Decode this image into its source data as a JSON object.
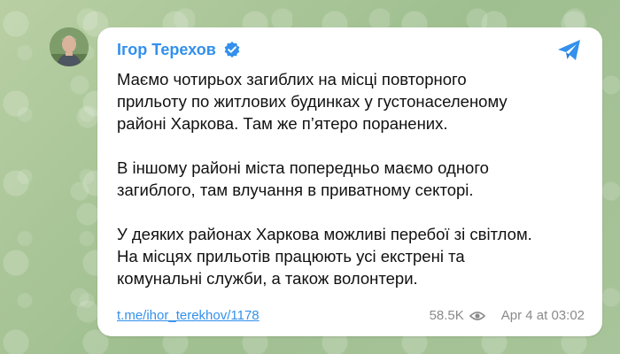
{
  "post": {
    "author": "Ігор Терехов",
    "paragraphs": [
      "Маємо чотирьох загиблих на місці повторного\nприльоту по житлових будинках у густонаселеному\nрайоні Харкова. Там же п’ятеро поранених.",
      "В іншому районі міста попередньо маємо одного\nзагиблого, там влучання в приватному секторі.",
      "У деяких районах Харкова можливі перебої зі світлом.\nНа місцях прильотів працюють усі екстрені та\nкомунальні служби, а також волонтери."
    ],
    "link": "t.me/ihor_terekhov/1178",
    "views": "58.5K",
    "date": "Apr 4 at 03:02"
  },
  "colors": {
    "accent": "#3390ec",
    "meta": "#8a8a8a",
    "text": "#111111"
  },
  "icons": {
    "verified": "verified-badge-icon",
    "share": "telegram-share-icon",
    "views": "eye-icon"
  }
}
